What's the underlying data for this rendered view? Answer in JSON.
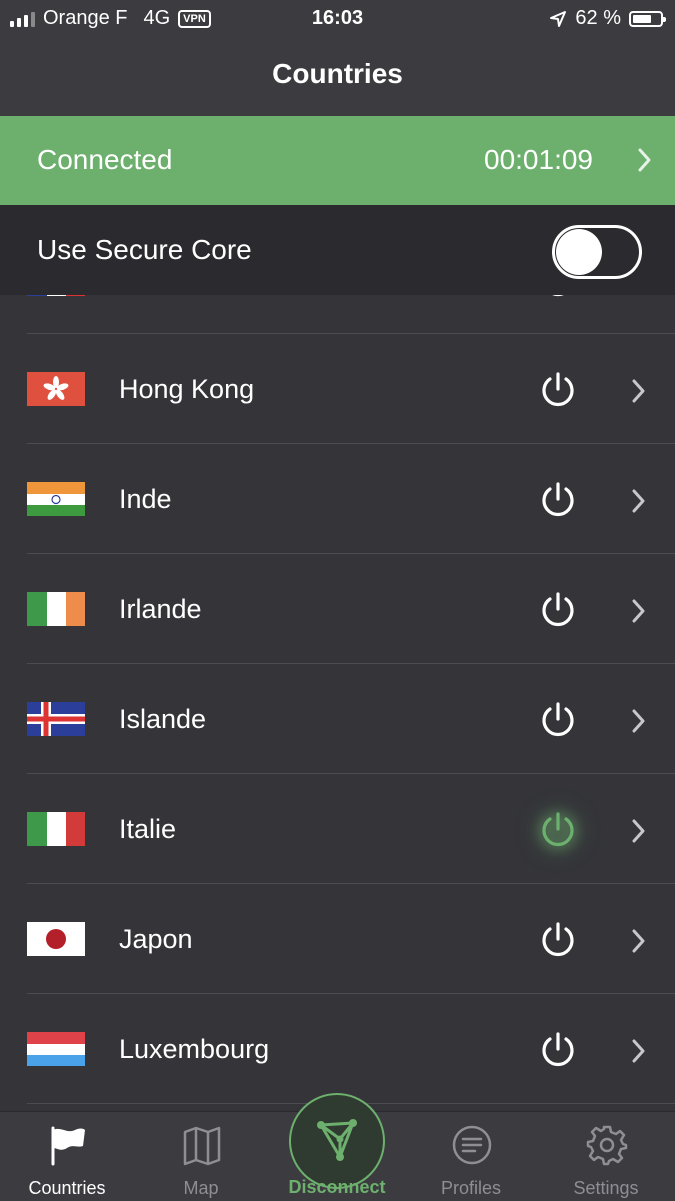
{
  "status_bar": {
    "carrier": "Orange F",
    "network": "4G",
    "vpn": "VPN",
    "time": "16:03",
    "battery": "62 %"
  },
  "header": {
    "title": "Countries"
  },
  "connection": {
    "status": "Connected",
    "duration": "00:01:09"
  },
  "secure_core": {
    "label": "Use Secure Core",
    "enabled": false
  },
  "countries": [
    {
      "name": "Hong Kong",
      "flag": "hong-kong-flag",
      "active": false
    },
    {
      "name": "Inde",
      "flag": "india-flag",
      "active": false
    },
    {
      "name": "Irlande",
      "flag": "ireland-flag",
      "active": false
    },
    {
      "name": "Islande",
      "flag": "iceland-flag",
      "active": false
    },
    {
      "name": "Italie",
      "flag": "italy-flag",
      "active": true
    },
    {
      "name": "Japon",
      "flag": "japan-flag",
      "active": false
    },
    {
      "name": "Luxembourg",
      "flag": "luxembourg-flag",
      "active": false
    }
  ],
  "tabbar": {
    "countries": "Countries",
    "map": "Map",
    "disconnect": "Disconnect",
    "profiles": "Profiles",
    "settings": "Settings"
  },
  "colors": {
    "accent": "#6db06e",
    "background": "#343439",
    "bar": "#3b3b40"
  }
}
